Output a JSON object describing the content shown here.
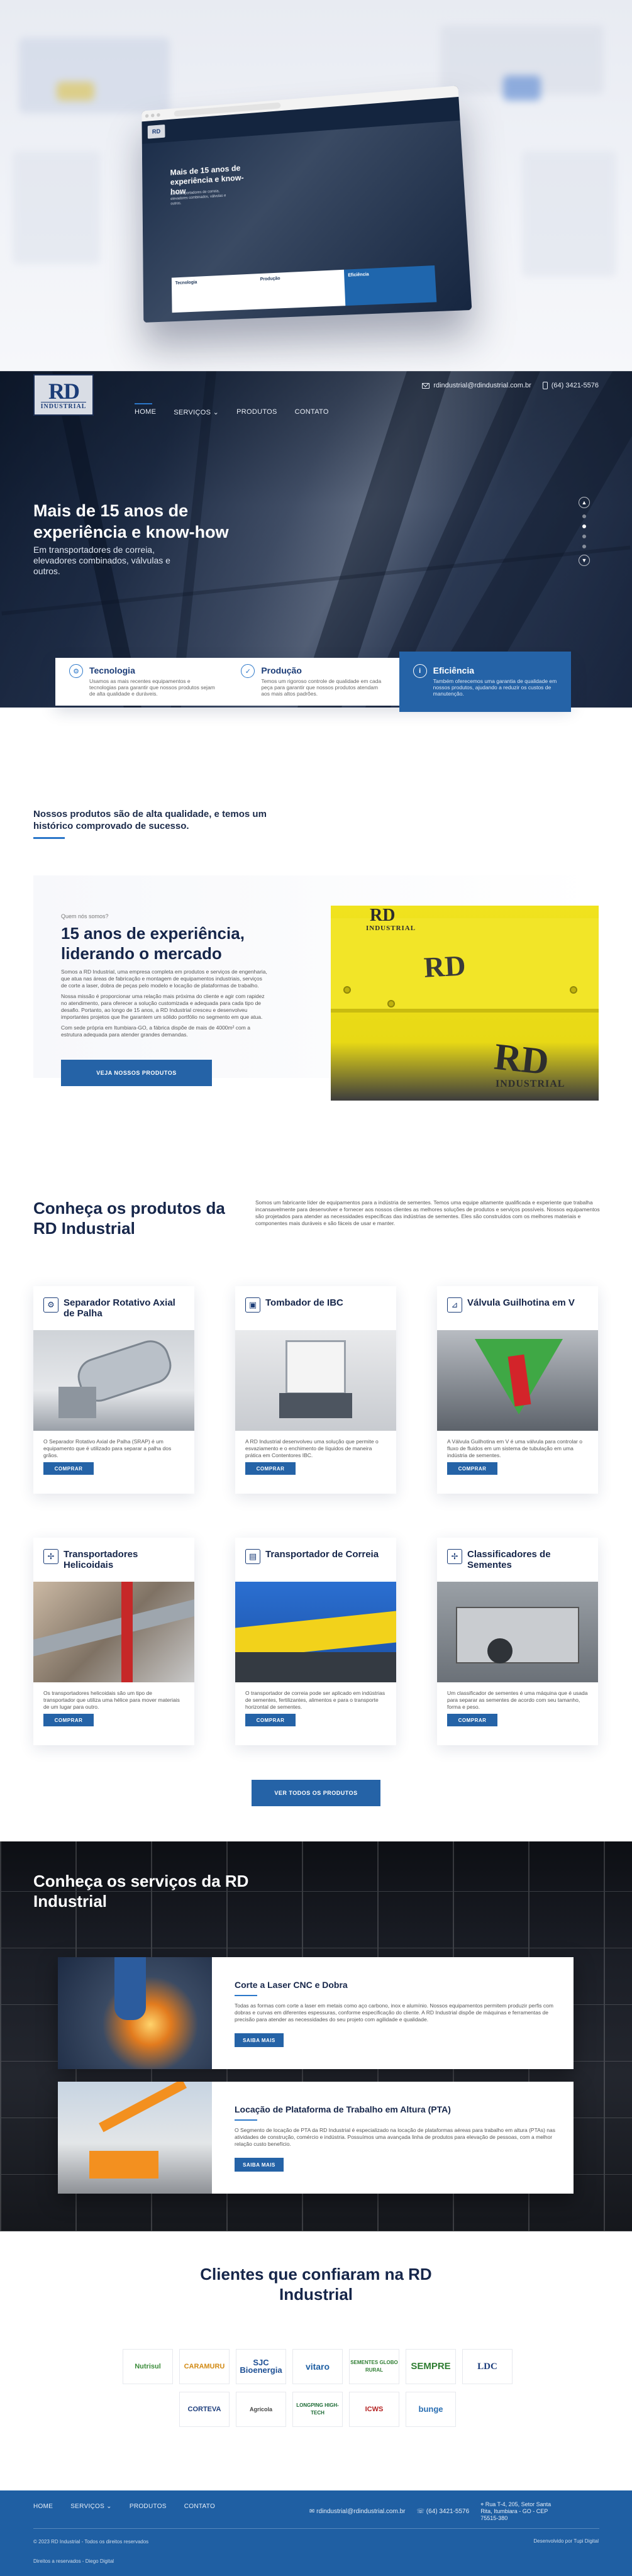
{
  "header": {
    "logo_text": "RD",
    "logo_sub": "INDUSTRIAL",
    "email": "rdindustrial@rdindustrial.com.br",
    "phone": "(64) 3421-5576",
    "nav": [
      "HOME",
      "SERVIÇOS ⌄",
      "PRODUTOS",
      "CONTATO"
    ]
  },
  "hero": {
    "title": "Mais de 15 anos de experiência e know-how",
    "subtitle": "Em transportadores de correia, elevadores combinados, válvulas e outros.",
    "slider_dots": 4,
    "active_dot": 1
  },
  "features": [
    {
      "icon": "gear-icon",
      "title": "Tecnologia",
      "text": "Usamos as mais recentes equipamentos e tecnologias para garantir que nossos produtos sejam de alta qualidade e duráveis."
    },
    {
      "icon": "check-icon",
      "title": "Produção",
      "text": "Temos um rigoroso controle de qualidade em cada peça para garantir que nossos produtos atendam aos mais altos padrões."
    },
    {
      "icon": "info-icon",
      "title": "Eficiência",
      "text": "Também oferecemos uma garantia de qualidade em nossos produtos, ajudando a reduzir os custos de manutenção."
    }
  ],
  "tagline": "Nossos produtos são de alta qualidade, e temos um histórico comprovado de sucesso.",
  "experience": {
    "eyebrow": "Quem nós somos?",
    "title": "15 anos de experiência, liderando o mercado",
    "paragraphs": [
      "Somos a RD Industrial, uma empresa completa em produtos e serviços de engenharia, que atua nas áreas de fabricação e montagem de equipamentos industriais, serviços de corte a laser, dobra de peças pelo modelo e locação de plataformas de trabalho.",
      "Nossa missão é proporcionar uma relação mais próxima do cliente e agir com rapidez no atendimento, para oferecer a solução customizada e adequada para cada tipo de desafio. Portanto, ao longo de 15 anos, a RD Industrial cresceu e desenvolveu importantes projetos que lhe garantem um sólido portfólio no segmento em que atua.",
      "Com sede própria em Itumbiara-GO, a fábrica dispõe de mais de 4000m² com a estrutura adequada para atender grandes demandas."
    ],
    "button": "VEJA NOSSOS PRODUTOS",
    "image_marks": [
      "RD",
      "INDUSTRIAL"
    ]
  },
  "products": {
    "title": "Conheça os produtos da RD Industrial",
    "intro": "Somos um fabricante líder de equipamentos para a indústria de sementes. Temos uma equipe altamente qualificada e experiente que trabalha incansavelmente para desenvolver e fornecer aos nossos clientes as melhores soluções de produtos e serviços possíveis. Nossos equipamentos são projetados para atender as necessidades específicas das indústrias de sementes. Eles são construídos com os melhores materiais e componentes mais duráveis e são fáceis de usar e manter.",
    "items": [
      {
        "icon": "gear-icon",
        "title": "Separador Rotativo Axial de Palha",
        "text": "O Separador Rotativo Axial de Palha (SRAP) é um equipamento que é utilizado para separar a palha dos grãos.",
        "button": "COMPRAR"
      },
      {
        "icon": "cube-icon",
        "title": "Tombador de IBC",
        "text": "A RD Industrial desenvolveu uma solução que permite o esvaziamento e o enchimento de líquidos de maneira prática em Contentores IBC.",
        "button": "COMPRAR"
      },
      {
        "icon": "valve-icon",
        "title": "Válvula Guilhotina em V",
        "text": "A Válvula Guilhotina em V é uma válvula para controlar o fluxo de fluidos em um sistema de tubulação em uma indústria de sementes.",
        "button": "COMPRAR"
      },
      {
        "icon": "fan-icon",
        "title": "Transportadores Helicoidais",
        "text": "Os transportadores helicoidais são um tipo de transportador que utiliza uma hélice para mover materiais de um lugar para outro.",
        "button": "COMPRAR"
      },
      {
        "icon": "belt-icon",
        "title": "Transportador de Correia",
        "text": "O transportador de correia pode ser aplicado em indústrias de sementes, fertilizantes, alimentos e para o transporte horizontal de sementes.",
        "button": "COMPRAR"
      },
      {
        "icon": "fan-icon",
        "title": "Classificadores de Sementes",
        "text": "Um classificador de sementes é uma máquina que é usada para separar as sementes de acordo com seu tamanho, forma e peso.",
        "button": "COMPRAR"
      }
    ],
    "all_button": "VER TODOS OS PRODUTOS"
  },
  "services": {
    "title": "Conheça os serviços da RD Industrial",
    "items": [
      {
        "title": "Corte a Laser CNC e Dobra",
        "text": "Todas as formas com corte a laser em metais como aço carbono, inox e alumínio. Nossos equipamentos permitem produzir perfis com dobras e curvas em diferentes espessuras, conforme especificação do cliente. A RD Industrial dispõe de máquinas e ferramentas de precisão para atender as necessidades do seu projeto com agilidade e qualidade.",
        "button": "SAIBA MAIS"
      },
      {
        "title": "Locação de Plataforma de Trabalho em Altura (PTA)",
        "text": "O Segmento de locação de PTA da RD Industrial é especializado na locação de plataformas aéreas para trabalho em altura (PTAs) nas atividades de construção, comércio e indústria. Possuímos uma avançada linha de produtos para elevação de pessoas, com a melhor relação custo benefício.",
        "button": "SAIBA MAIS"
      }
    ]
  },
  "clients": {
    "title": "Clientes que confiaram na RD Industrial",
    "row1": [
      "Nutrisul",
      "CARAMURU",
      "SJC Bioenergia",
      "vitaro",
      "SEMENTES GLOBO RURAL",
      "SEMPRE",
      "LDC"
    ],
    "row2": [
      "CORTEVA",
      "Agrícola",
      "LONGPING HIGH-TECH",
      "ICWS",
      "bunge"
    ]
  },
  "footer": {
    "nav": [
      "HOME",
      "SERVIÇOS ⌄",
      "PRODUTOS",
      "CONTATO"
    ],
    "email": "rdindustrial@rdindustrial.com.br",
    "phone": "(64) 3421-5576",
    "address": "Rua T-4, 205, Setor Santa Rita, Itumbiara - GO - CEP 75515-380",
    "copyright": "© 2023 RD Industrial - Todos os direitos reservados",
    "developer": "Desenvolvido por Tupi Digital",
    "whatsapp": "Direitos a reservados - Diego Digital"
  },
  "colors": {
    "accent": "#2563a7",
    "navy": "#16264a",
    "footer": "#1f5fa3"
  }
}
